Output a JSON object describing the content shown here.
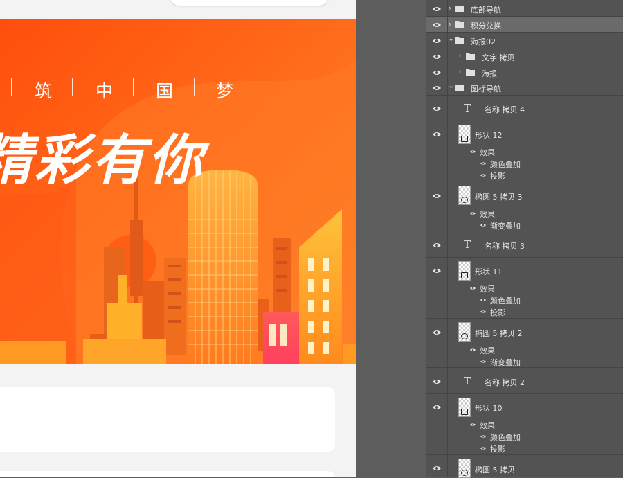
{
  "canvas": {
    "poster": {
      "slogan_chars": [
        "筑",
        "中",
        "国",
        "梦"
      ],
      "headline": "精彩有你"
    }
  },
  "layers_panel": {
    "rows": [
      {
        "name": "底部导航",
        "kind": "group",
        "expanded": false,
        "selected": false
      },
      {
        "name": "积分兑换",
        "kind": "group",
        "expanded": false,
        "selected": true
      },
      {
        "name": "海报02",
        "kind": "group",
        "expanded": true,
        "selected": false
      },
      {
        "name": "文字 拷贝",
        "kind": "group",
        "expanded": false,
        "selected": false
      },
      {
        "name": "海报",
        "kind": "group",
        "expanded": false,
        "selected": false
      },
      {
        "name": "图标导航",
        "kind": "group",
        "expanded": true,
        "selected": false
      },
      {
        "name": "名称 拷贝 4",
        "kind": "text"
      },
      {
        "name": "形状 12",
        "kind": "shape",
        "effects_label": "效果",
        "effects": [
          "颜色叠加",
          "投影"
        ]
      },
      {
        "name": "椭圆 5 拷贝 3",
        "kind": "shape",
        "effects_label": "效果",
        "effects": [
          "渐变叠加"
        ]
      },
      {
        "name": "名称 拷贝 3",
        "kind": "text"
      },
      {
        "name": "形状 11",
        "kind": "shape",
        "effects_label": "效果",
        "effects": [
          "颜色叠加",
          "投影"
        ]
      },
      {
        "name": "椭圆 5 拷贝 2",
        "kind": "shape",
        "effects_label": "效果",
        "effects": [
          "渐变叠加"
        ]
      },
      {
        "name": "名称 拷贝 2",
        "kind": "text"
      },
      {
        "name": "形状 10",
        "kind": "shape",
        "effects_label": "效果",
        "effects": [
          "颜色叠加",
          "投影"
        ]
      },
      {
        "name": "椭圆 5 拷贝",
        "kind": "shape"
      }
    ]
  },
  "colors": {
    "poster_orange": "#ff6a1f",
    "poster_deep": "#ff4a0a",
    "building_yellow": "#ffb12a",
    "panel_bg": "#535353",
    "panel_selected": "#6a6a6a"
  }
}
